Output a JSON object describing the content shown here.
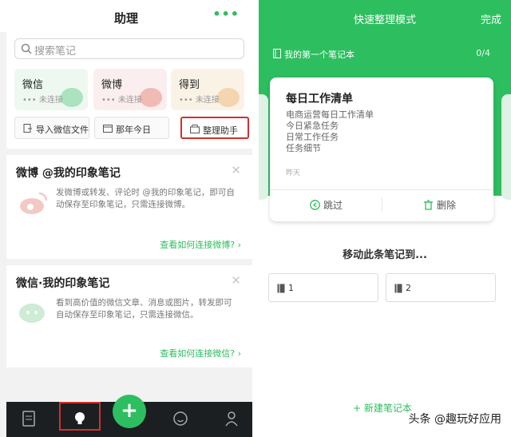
{
  "left": {
    "header": {
      "title": "助理",
      "more_label": "•••"
    },
    "search": {
      "placeholder": "搜索笔记"
    },
    "services": [
      {
        "name": "微信",
        "status": "未连接"
      },
      {
        "name": "微博",
        "status": "未连接"
      },
      {
        "name": "得到",
        "status": "未连接"
      }
    ],
    "actions": [
      {
        "label": "导入微信文件"
      },
      {
        "label": "那年今日"
      },
      {
        "label": "整理助手"
      }
    ],
    "cards": [
      {
        "title": "微博 @我的印象笔记",
        "desc": "发微博或转发、评论时 @我的印象笔记，即可自动保存至印象笔记，只需连接微博。",
        "link": "查看如何连接微博?"
      },
      {
        "title": "微信·我的印象笔记",
        "desc": "看到高价值的微信文章、消息或图片，转发即可自动保存至印象笔记，只需连接微信。",
        "link": "查看如何连接微信?"
      }
    ],
    "fab_label": "+"
  },
  "right": {
    "header": {
      "title": "快速整理模式",
      "done": "完成"
    },
    "notebook": {
      "name": "我的第一个笔记本",
      "count": "0/4"
    },
    "note": {
      "title": "每日工作清单",
      "lines": [
        "电商运营每日工作清单",
        "今日紧急任务",
        "日常工作任务",
        "任务细节"
      ],
      "date": "昨天",
      "skip": "跳过",
      "delete": "删除"
    },
    "move_to": "移动此条笔记到...",
    "targets": [
      "1",
      "2"
    ],
    "new_notebook": "+ 新建笔记本",
    "watermark": "头条 @趣玩好应用"
  },
  "colors": {
    "accent": "#2dbe60",
    "highlight": "#d0302f",
    "tabbar": "#1b1f22"
  }
}
